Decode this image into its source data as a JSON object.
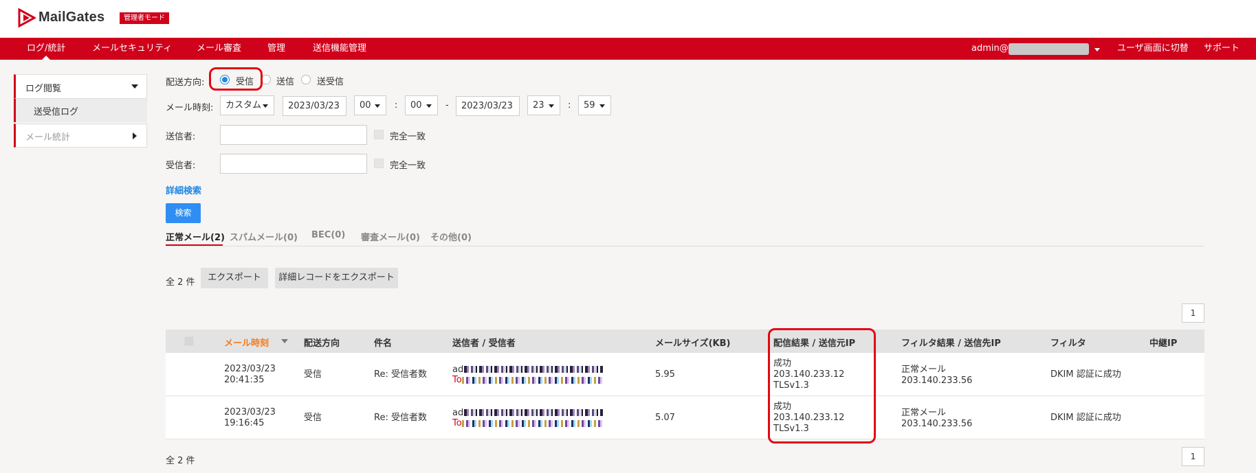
{
  "brand": {
    "name": "MailGates",
    "badge": "管理者モード"
  },
  "nav": {
    "items": [
      "ログ/統計",
      "メールセキュリティ",
      "メール審査",
      "管理",
      "送信機能管理"
    ],
    "user": "admin@",
    "user_switch": "ユーザ画面に切替",
    "support": "サポート"
  },
  "sidebar": {
    "log_view": "ログ閲覧",
    "send_receive_log": "送受信ログ",
    "mail_stats": "メール統計"
  },
  "form": {
    "direction_label": "配送方向:",
    "direction_options": [
      "受信",
      "送信",
      "送受信"
    ],
    "direction_selected": "受信",
    "mail_time_label": "メール時刻:",
    "time_mode": "カスタム",
    "start_date": "2023/03/23",
    "start_hour": "00",
    "start_min": "00",
    "colon": ":",
    "dash": "-",
    "end_date": "2023/03/23",
    "end_hour": "23",
    "end_min": "59",
    "sender_label": "送信者:",
    "recipient_label": "受信者:",
    "exact_match": "完全一致",
    "advanced_search": "詳細検索",
    "search_button": "検索"
  },
  "tabs": [
    "正常メール(2)",
    "スパムメール(0)",
    "BEC(0)",
    "審査メール(0)",
    "その他(0)"
  ],
  "toolbar": {
    "total": "全 2 件",
    "export": "エクスポート",
    "export_detail": "詳細レコードをエクスポート",
    "page": "1"
  },
  "table": {
    "headers": [
      "メール時刻",
      "配送方向",
      "件名",
      "送信者 / 受信者",
      "メールサイズ(KB)",
      "配信結果 / 送信元IP",
      "フィルタ結果 / 送信先IP",
      "フィルタ",
      "中継IP"
    ],
    "rows": [
      {
        "date": "2023/03/23",
        "time": "20:41:35",
        "direction": "受信",
        "subject": "Re: 受信者数",
        "sender_prefix": "ad",
        "recipient_prefix": "To",
        "size": "5.95",
        "result": "成功",
        "source_ip": "203.140.233.12",
        "tls": "TLSv1.3",
        "filter_result": "正常メール",
        "dest_ip": "203.140.233.56",
        "filter": "DKIM 認証に成功"
      },
      {
        "date": "2023/03/23",
        "time": "19:16:45",
        "direction": "受信",
        "subject": "Re: 受信者数",
        "sender_prefix": "ad",
        "recipient_prefix": "To",
        "size": "5.07",
        "result": "成功",
        "source_ip": "203.140.233.12",
        "tls": "TLSv1.3",
        "filter_result": "正常メール",
        "dest_ip": "203.140.233.56",
        "filter": "DKIM 認証に成功"
      }
    ]
  },
  "footer": {
    "total": "全 2 件",
    "page": "1"
  },
  "colors": {
    "brand_red": "#d0021b",
    "link_blue": "#1e88e5",
    "sort_orange": "#f47b20",
    "highlight_red": "#e30613"
  }
}
